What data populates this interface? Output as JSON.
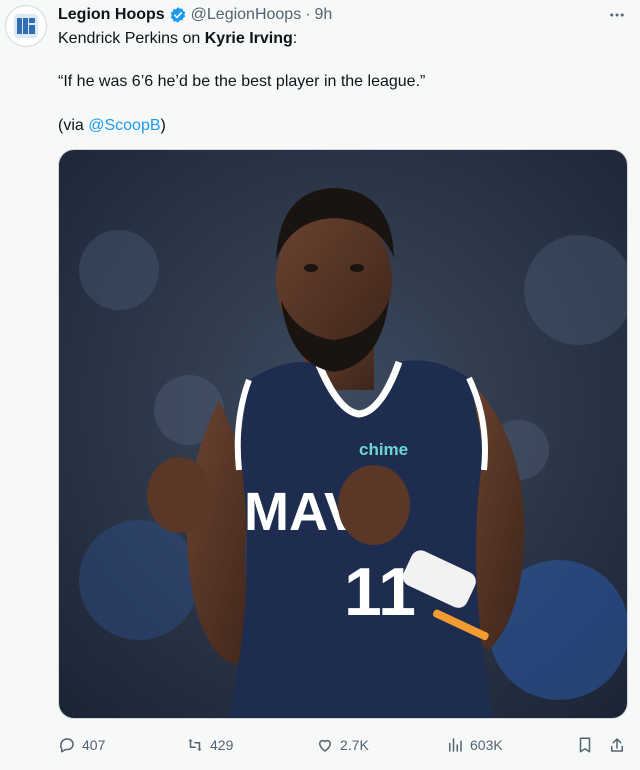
{
  "author": {
    "name": "Legion Hoops",
    "handle": "@LegionHoops",
    "separator": "·",
    "time": "9h",
    "avatar_icon": "legion-hoops-logo"
  },
  "tweet": {
    "line1_prefix": "Kendrick Perkins on ",
    "line1_bold": "Kyrie Irving",
    "line1_suffix": ":",
    "quote": "“If he was 6’6 he’d be the best player in the league.”",
    "via_prefix": "(via ",
    "via_mention": "@ScoopB",
    "via_suffix": ")"
  },
  "media": {
    "jersey_text": "MAVS",
    "jersey_number": "11",
    "sponsor": "chime"
  },
  "actions": {
    "replies": "407",
    "reposts": "429",
    "likes": "2.7K",
    "views": "603K"
  },
  "colors": {
    "accent": "#1d9bf0",
    "jersey": "#1d2c4f",
    "muted": "#536471"
  }
}
